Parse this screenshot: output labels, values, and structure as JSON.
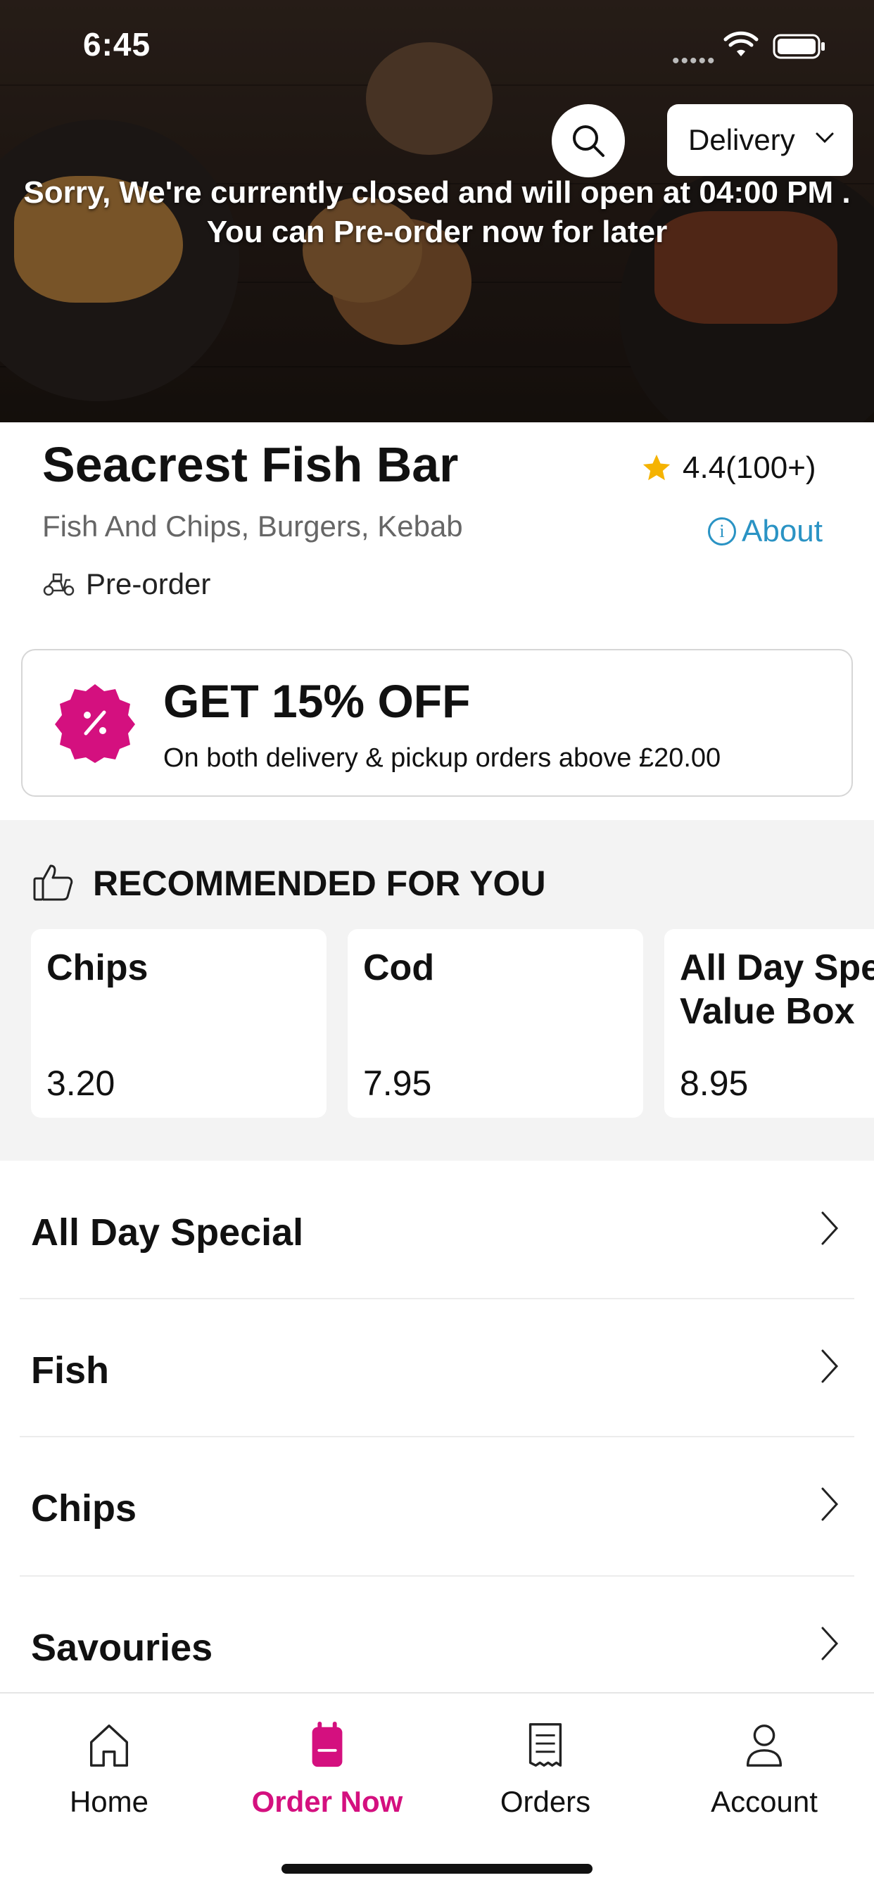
{
  "status_bar": {
    "time": "6:45",
    "signal": "•••••"
  },
  "header": {
    "delivery_label": "Delivery",
    "closed_message_line1": "Sorry, We're currently closed and will open at 04:00 PM .",
    "closed_message_line2": "You can Pre-order now for later"
  },
  "restaurant": {
    "name": "Seacrest Fish Bar",
    "rating": "4.4(100+)",
    "cuisine": "Fish And Chips, Burgers, Kebab",
    "about_label": "About",
    "about_icon_glyph": "i",
    "preorder_label": "Pre-order"
  },
  "promo": {
    "title": "GET 15% OFF",
    "subtitle": "On both delivery & pickup orders above £20.00",
    "accent": "#d4107f"
  },
  "recommended": {
    "title": "RECOMMENDED FOR YOU",
    "items": [
      {
        "name": "Chips",
        "price": "3.20"
      },
      {
        "name": "Cod",
        "price": "7.95"
      },
      {
        "name": "All Day Spec\nValue Box",
        "price": "8.95"
      }
    ]
  },
  "categories": [
    {
      "label": "All Day Special"
    },
    {
      "label": "Fish"
    },
    {
      "label": "Chips"
    },
    {
      "label": "Savouries"
    }
  ],
  "tabs": [
    {
      "label": "Home",
      "icon": "home-icon"
    },
    {
      "label": "Order Now",
      "icon": "order-icon",
      "active": true
    },
    {
      "label": "Orders",
      "icon": "receipt-icon"
    },
    {
      "label": "Account",
      "icon": "user-icon"
    }
  ],
  "colors": {
    "accent": "#d4107f",
    "link": "#2a93c4",
    "star": "#f5b301"
  }
}
